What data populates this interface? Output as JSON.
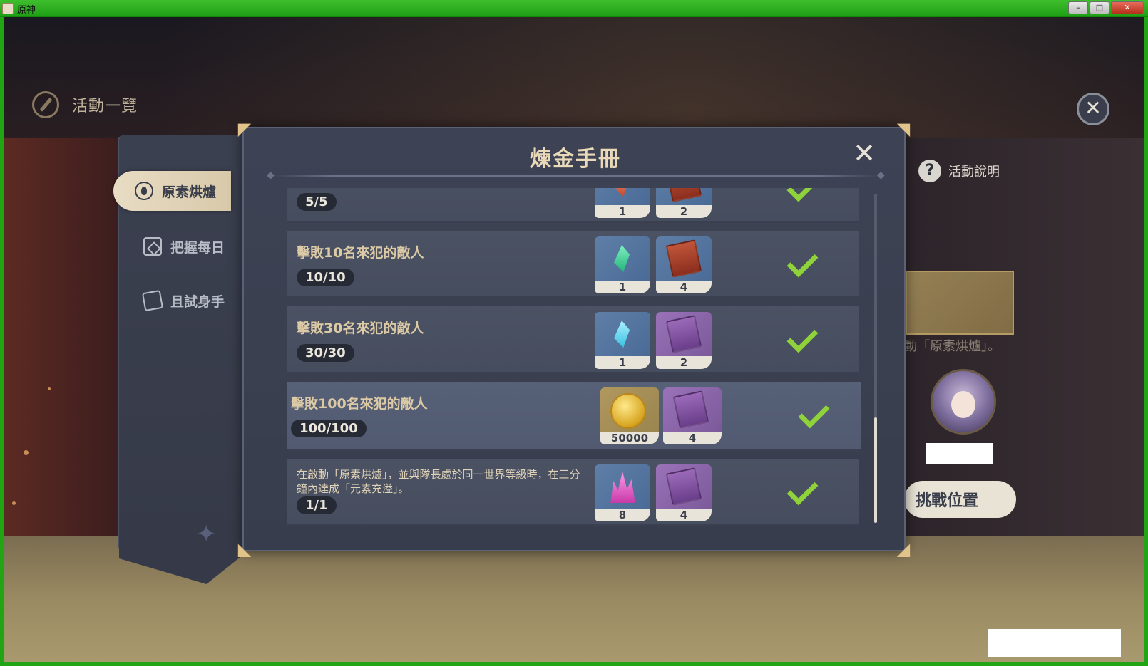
{
  "window": {
    "title": "原神",
    "minimize_label": "–",
    "maximize_label": "□",
    "close_label": "✕"
  },
  "header": {
    "title": "活動一覽",
    "close_label": "✕"
  },
  "sidebar": {
    "items": [
      {
        "label": "原素烘爐",
        "icon": "furnace-icon",
        "active": true
      },
      {
        "label": "把握每日",
        "icon": "calendar-icon",
        "active": false
      },
      {
        "label": "且試身手",
        "icon": "cards-icon",
        "active": false
      }
    ]
  },
  "right_panel": {
    "help_label": "活動說明",
    "help_icon_label": "?",
    "hint": "動「原素烘爐」。",
    "challenge_label": "挑戰位置"
  },
  "dialog": {
    "title": "煉金手冊",
    "close_label": "✕",
    "rows": [
      {
        "task": "",
        "progress": "5/5",
        "rewards": [
          {
            "icon": "red-crystal-icon",
            "qty": "1"
          },
          {
            "icon": "red-book-icon",
            "qty": "2"
          }
        ],
        "completed": true
      },
      {
        "task": "擊敗10名來犯的敵人",
        "progress": "10/10",
        "rewards": [
          {
            "icon": "green-crystal-icon",
            "qty": "1"
          },
          {
            "icon": "red-book-icon",
            "qty": "4"
          }
        ],
        "completed": true
      },
      {
        "task": "擊敗30名來犯的敵人",
        "progress": "30/30",
        "rewards": [
          {
            "icon": "cyan-crystal-icon",
            "qty": "1"
          },
          {
            "icon": "violet-book-icon",
            "qty": "2"
          }
        ],
        "completed": true
      },
      {
        "task": "擊敗100名來犯的敵人",
        "progress": "100/100",
        "rewards": [
          {
            "icon": "mora-coin-icon",
            "qty": "50000"
          },
          {
            "icon": "violet-book-icon",
            "qty": "4"
          }
        ],
        "completed": true
      },
      {
        "task": "在啟動「原素烘爐」，並與隊長處於同一世界等級時，在三分鐘內達成「元素充溢」。",
        "progress": "1/1",
        "rewards": [
          {
            "icon": "pink-crystal-icon",
            "qty": "8"
          },
          {
            "icon": "violet-book-icon",
            "qty": "4"
          }
        ],
        "completed": true
      }
    ]
  },
  "colors": {
    "accent_gold": "#e9d9b8",
    "check_green": "#8fd23a",
    "dialog_bg": "#3d4354"
  }
}
